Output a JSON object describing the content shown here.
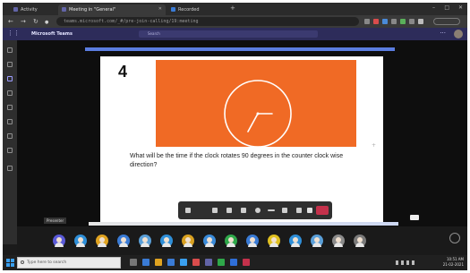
{
  "browser": {
    "tabs": [
      {
        "label": "Activity",
        "icon": "teams-tab-icon",
        "color": "#6264a7"
      },
      {
        "label": "Meeting in \"General\"",
        "icon": "teams-tab-icon",
        "color": "#6264a7"
      },
      {
        "label": "Recorded",
        "icon": "video-tab-icon",
        "color": "#3a7bd5"
      }
    ],
    "url": "teams.microsoft.com/_#/pre-join-calling/19:meeting"
  },
  "app": {
    "title": "Microsoft Teams",
    "search_placeholder": "Search"
  },
  "slide": {
    "number": "4",
    "question": "What will be the time if the clock rotates 90 degrees in the counter clock wise direction?",
    "accent_color": "#f06a25"
  },
  "meeting": {
    "presenter_label": "Presenter"
  },
  "participants": [
    {
      "color": "#5a5ad8"
    },
    {
      "color": "#2f8fd8"
    },
    {
      "color": "#e0a320"
    },
    {
      "color": "#3a7bd5"
    },
    {
      "color": "#5a9fd8"
    },
    {
      "color": "#2f8fd8"
    },
    {
      "color": "#d8a020"
    },
    {
      "color": "#3a8ad8"
    },
    {
      "color": "#2fa84a"
    },
    {
      "color": "#3a7bd5"
    },
    {
      "color": "#e0c020"
    },
    {
      "color": "#2f8fd8"
    },
    {
      "color": "#5a9fd8"
    },
    {
      "color": "#8a8a8a"
    },
    {
      "color": "#7a7a7a"
    }
  ],
  "taskbar": {
    "search_placeholder": "Type here to search",
    "time": "10:51 AM",
    "date": "21-02-2021"
  },
  "colors": {
    "teams_bar": "#2d2c5a",
    "hangup": "#c4314b"
  }
}
